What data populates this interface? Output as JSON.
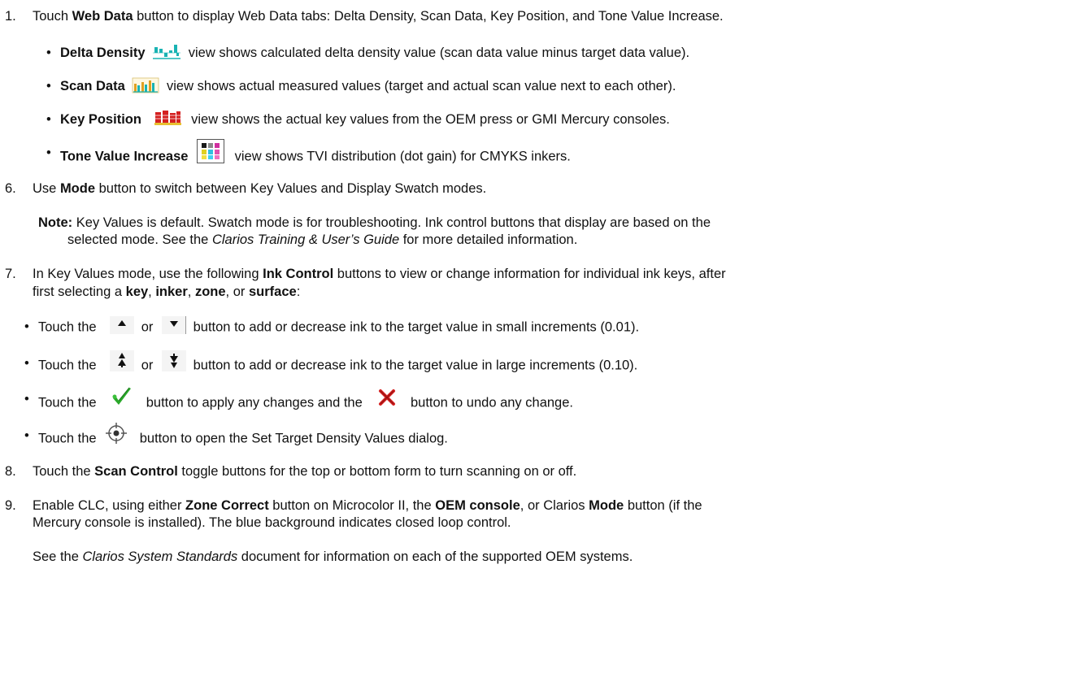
{
  "steps": {
    "s1": {
      "num": "1.",
      "pre": "Touch ",
      "bold": "Web Data",
      "post": " button to display Web Data tabs: Delta Density, Scan Data, Key Position, and Tone Value Increase."
    },
    "bullets1": [
      {
        "bold": "Delta Density",
        "icon": "delta-density-icon",
        "text": " view shows calculated delta density value (scan data value minus target data value)."
      },
      {
        "bold": "Scan Data",
        "icon": "scan-data-icon",
        "text": " view shows actual measured values (target and actual scan value next to each other)."
      },
      {
        "bold": "Key Position",
        "icon": "key-position-icon",
        "text": " view shows the actual key values from the OEM press or GMI Mercury consoles."
      },
      {
        "bold": "Tone Value Increase",
        "icon": "tone-value-increase-icon",
        "text": " view shows TVI distribution (dot gain) for CMYKS inkers."
      }
    ],
    "s6": {
      "num": "6.",
      "pre": "Use ",
      "bold": "Mode",
      "post": " button to switch between Key Values and Display Swatch modes."
    },
    "note": {
      "label": "Note:",
      "line1": " Key Values is default. Swatch mode is for troubleshooting. Ink control buttons that display are based on the",
      "line2_pre": "selected mode. See the ",
      "line2_italic": "Clarios Training & User’s Guide",
      "line2_post": " for more detailed information."
    },
    "s7": {
      "num": "7.",
      "line1_pre": "In Key Values mode, use the following ",
      "line1_bold": "Ink Control",
      "line1_post": " buttons to view or change information for individual ink keys, after",
      "line2_pre": "first selecting a ",
      "k1": "key",
      "sep1": ", ",
      "k2": "inker",
      "sep2": ", ",
      "k3": "zone",
      "sep3": ", or ",
      "k4": "surface",
      "end": ":"
    },
    "bullets2": {
      "b1_pre": "Touch the",
      "b1_or": "or",
      "b1_post": "button to add or decrease ink to the target value in small increments (0.01).",
      "b2_pre": "Touch the",
      "b2_or": "or",
      "b2_post": "button to add or decrease ink to the target value in large increments (0.10).",
      "b3_pre": "Touch the",
      "b3_mid": "button to apply any changes and the",
      "b3_post": "button to undo any change.",
      "b4_pre": "Touch the",
      "b4_post": "button to open the Set Target Density Values dialog."
    },
    "s8": {
      "num": "8.",
      "pre": "Touch the ",
      "bold": "Scan Control",
      "post": " toggle buttons for the top or bottom form to turn scanning on or off."
    },
    "s9": {
      "num": "9.",
      "l1_a": "Enable CLC, using either ",
      "l1_b": "Zone Correct",
      "l1_c": " button on Microcolor II, the ",
      "l1_d": "OEM console",
      "l1_e": ", or Clarios ",
      "l1_f": "Mode",
      "l1_g": " button (if the",
      "l2": "Mercury console is installed). The blue background indicates closed loop control.",
      "l3_pre": "See the ",
      "l3_italic": "Clarios System Standards",
      "l3_post": " document for information on each of the supported OEM systems."
    }
  },
  "bullet_char": "•",
  "colors": {
    "text": "#111111",
    "teal": "#19b3b3",
    "red": "#d42020",
    "green": "#2aa82a",
    "gray": "#7a7a7a"
  }
}
